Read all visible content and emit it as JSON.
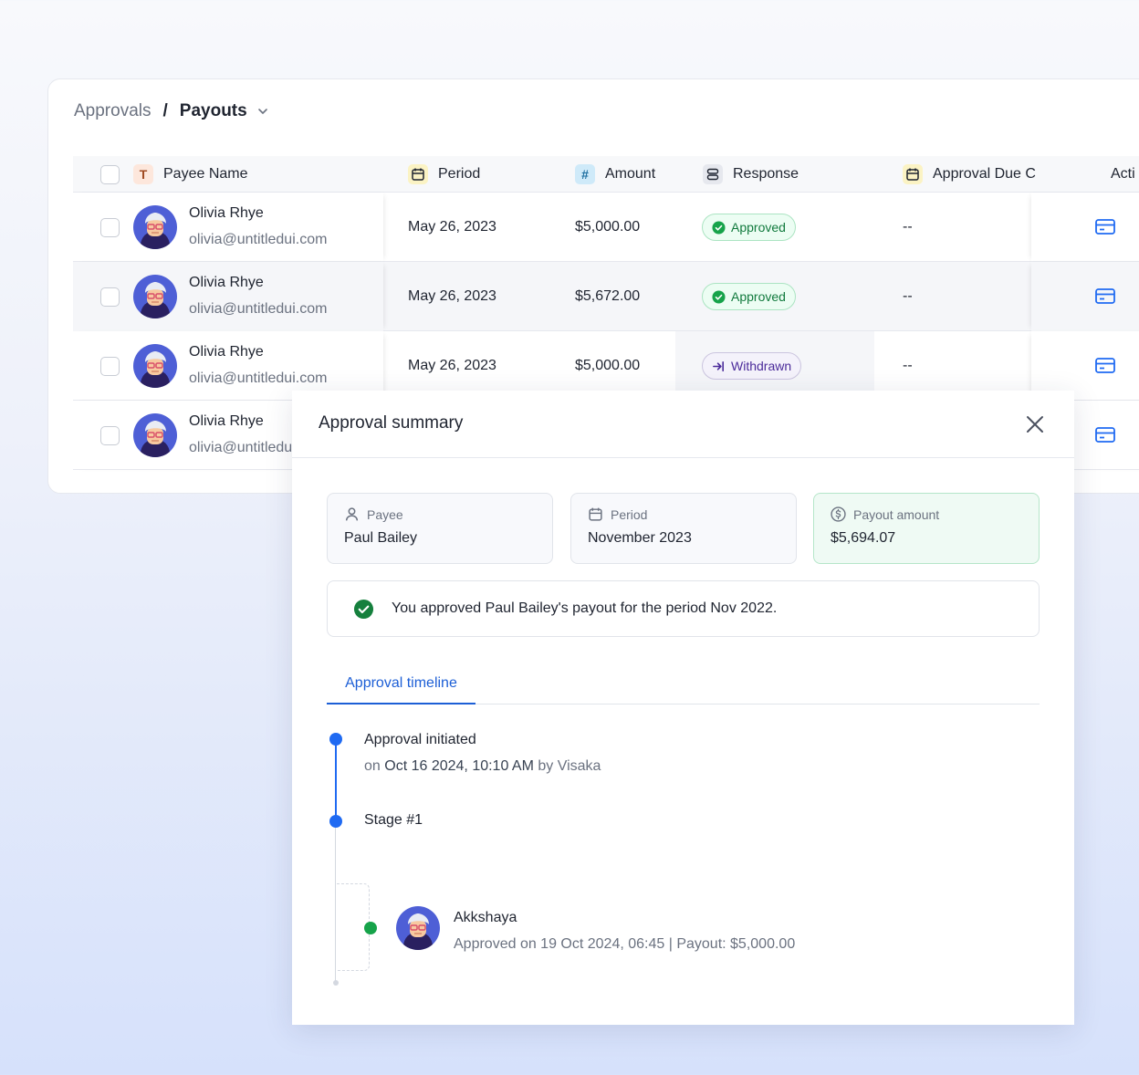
{
  "breadcrumb": {
    "root": "Approvals",
    "separator": "/",
    "current": "Payouts"
  },
  "table": {
    "columns": {
      "payee_name": "Payee Name",
      "period": "Period",
      "amount": "Amount",
      "response": "Response",
      "approval_due": "Approval Due C",
      "actions": "Acti"
    },
    "rows": [
      {
        "name": "Olivia Rhye",
        "email": "olivia@untitledui.com",
        "period": "May 26, 2023",
        "amount": "$5,000.00",
        "response": "Approved",
        "due": "--"
      },
      {
        "name": "Olivia Rhye",
        "email": "olivia@untitledui.com",
        "period": "May 26, 2023",
        "amount": "$5,672.00",
        "response": "Approved",
        "due": "--"
      },
      {
        "name": "Olivia Rhye",
        "email": "olivia@untitledui.com",
        "period": "May 26, 2023",
        "amount": "$5,000.00",
        "response": "Withdrawn",
        "due": "--"
      },
      {
        "name": "Olivia Rhye",
        "email": "olivia@untitledu"
      }
    ]
  },
  "modal": {
    "title": "Approval summary",
    "cards": {
      "payee": {
        "label": "Payee",
        "value": "Paul Bailey"
      },
      "period": {
        "label": "Period",
        "value": "November 2023"
      },
      "payout": {
        "label": "Payout amount",
        "value": "$5,694.07"
      }
    },
    "notice": "You approved Paul Bailey's payout for the period Nov 2022.",
    "tab": "Approval timeline",
    "timeline": {
      "initiated": {
        "title": "Approval initiated",
        "on": "on",
        "date": "Oct 16 2024, 10:10 AM",
        "by": "by Visaka"
      },
      "stage": {
        "title": "Stage #1"
      },
      "approver": {
        "name": "Akkshaya",
        "detail": "Approved on 19 Oct 2024, 06:45 | Payout: $5,000.00"
      }
    }
  },
  "colors": {
    "accent": "#1f6af2",
    "approved": "#117a3d",
    "withdrawn": "#4b2b9a"
  }
}
